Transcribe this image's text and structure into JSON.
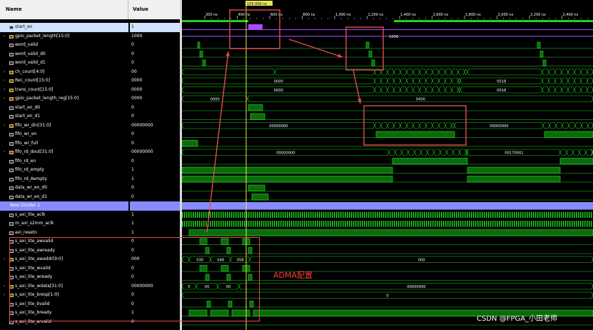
{
  "columns": {
    "name": "Name",
    "value": "Value"
  },
  "cursor_time": "155.000 ns",
  "time_ticks": [
    "200 ns",
    "400 ns",
    "600 ns",
    "800 ns",
    "1,000 ns",
    "1,200 ns",
    "1,400 ns",
    "1,600 ns",
    "1,800 ns",
    "2,000 ns",
    "2,200 ns",
    "2,400 ns"
  ],
  "signals": [
    {
      "name": "start_en",
      "value": "1",
      "type": "bit",
      "selected": true
    },
    {
      "name": "gpio_packet_length[15:0]",
      "value": "1000",
      "type": "bus",
      "expandable": true
    },
    {
      "name": "word_valid",
      "value": "0",
      "type": "bit"
    },
    {
      "name": "word_valid_d0",
      "value": "0",
      "type": "bit"
    },
    {
      "name": "word_valid_d1",
      "value": "0",
      "type": "bit"
    },
    {
      "name": "ch_count[4:0]",
      "value": "00",
      "type": "bus",
      "expandable": true
    },
    {
      "name": "Rec_count[15:0]",
      "value": "0000",
      "type": "bus",
      "expandable": true
    },
    {
      "name": "trans_count[15:0]",
      "value": "0000",
      "type": "bus",
      "expandable": true
    },
    {
      "name": "gpio_packet_length_reg[15:0]",
      "value": "0000",
      "type": "bus",
      "expandable": true
    },
    {
      "name": "start_en_d0",
      "value": "0",
      "type": "bit"
    },
    {
      "name": "start_en_d1",
      "value": "0",
      "type": "bit"
    },
    {
      "name": "fifo_wr_din[31:0]",
      "value": "00000000",
      "type": "bus",
      "expandable": true
    },
    {
      "name": "fifo_wr_en",
      "value": "0",
      "type": "bit"
    },
    {
      "name": "fifo_wr_full",
      "value": "0",
      "type": "bit"
    },
    {
      "name": "fifo_rd_dout[31:0]",
      "value": "00000000",
      "type": "bus",
      "expandable": true
    },
    {
      "name": "fifo_rd_en",
      "value": "0",
      "type": "bit"
    },
    {
      "name": "fifo_rd_empty",
      "value": "1",
      "type": "bit"
    },
    {
      "name": "fifo_rd_Aempty",
      "value": "1",
      "type": "bit"
    },
    {
      "name": "data_wr_en_d0",
      "value": "0",
      "type": "bit"
    },
    {
      "name": "data_wr_en_d1",
      "value": "0",
      "type": "bit"
    },
    {
      "name": "New Divider 1",
      "value": "",
      "type": "divider"
    },
    {
      "name": "s_axi_lite_aclk",
      "value": "1",
      "type": "bit"
    },
    {
      "name": "m_axi_s2mm_aclk",
      "value": "1",
      "type": "bit"
    },
    {
      "name": "axi_resetn",
      "value": "1",
      "type": "bit"
    },
    {
      "name": "s_axi_lite_awvalid",
      "value": "0",
      "type": "bit"
    },
    {
      "name": "s_axi_lite_awready",
      "value": "0",
      "type": "bit"
    },
    {
      "name": "s_axi_lite_awaddr[9:0]",
      "value": "000",
      "type": "bus",
      "expandable": true
    },
    {
      "name": "s_axi_lite_wvalid",
      "value": "0",
      "type": "bit"
    },
    {
      "name": "s_axi_lite_wready",
      "value": "0",
      "type": "bit"
    },
    {
      "name": "s_axi_lite_wdata[31:0]",
      "value": "00000000",
      "type": "bus",
      "expandable": true
    },
    {
      "name": "s_axi_lite_bresp[1:0]",
      "value": "0",
      "type": "bus",
      "expandable": true
    },
    {
      "name": "s_axi_lite_bvalid",
      "value": "0",
      "type": "bit"
    },
    {
      "name": "s_axi_lite_bready",
      "value": "1",
      "type": "bit"
    },
    {
      "name": "s_axi_lite_arvalid",
      "value": "0",
      "type": "bit"
    }
  ],
  "bus_values": {
    "gpio_packet_length": "1000",
    "rec_count": [
      "0000",
      "0018"
    ],
    "trans_count": [
      "0000",
      "0018"
    ],
    "gpio_packet_length_reg": [
      "0000",
      "0400"
    ],
    "fifo_wr_din": [
      "00000000",
      "00000000"
    ],
    "fifo_rd_dout": [
      "00000000",
      "00170001"
    ],
    "awaddr": [
      "030",
      "048",
      "058",
      "000"
    ],
    "wdata": [
      "0",
      "00",
      "00",
      "00000000"
    ],
    "bresp": "0"
  },
  "annotation": {
    "label": "ADMA配置",
    "color": "#ff3b3b"
  },
  "watermark": "CSDN @FPGA_小田老师",
  "colors": {
    "wave": "#1fd21f",
    "wave_fill": "#0c6a0c",
    "bus": "#1fd21f",
    "purple": "#a64dff",
    "cursor": "#e6e65a",
    "annotation_box": "#e74c4c",
    "divider": "#8a8aff",
    "selected_row": "#cfe2ff"
  }
}
